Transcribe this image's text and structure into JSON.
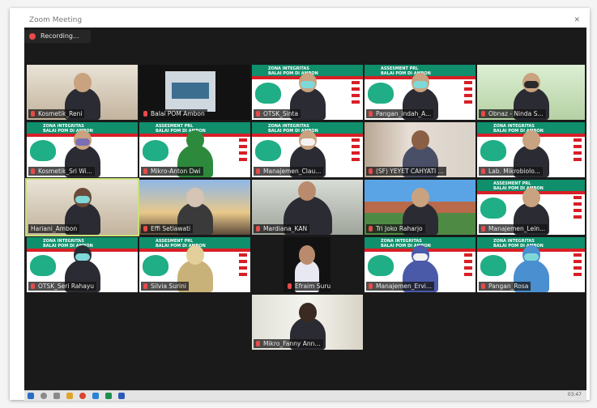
{
  "window": {
    "title": "Zoom Meeting",
    "close_glyph": "✕"
  },
  "recording": {
    "label": "Recording..."
  },
  "banner": {
    "line1": "ZONA INTEGRITAS",
    "line2": "BALAI POM DI AMBON",
    "line3": "ASSESMENT PRL"
  },
  "participants": [
    {
      "name": "Kosmetik_Reni"
    },
    {
      "name": "Balai POM Ambon"
    },
    {
      "name": "OTSK_Sinta"
    },
    {
      "name": "Pangan_indah_A..."
    },
    {
      "name": "Obnaz - Ninda S..."
    },
    {
      "name": "Kosmetik_Sri Wi..."
    },
    {
      "name": "Mikro-Anton Dwi"
    },
    {
      "name": "Manajemen_Clau..."
    },
    {
      "name": "(SF) YEYET CAHYATI ..."
    },
    {
      "name": "Lab. Mikrobiolo..."
    },
    {
      "name": "Hariani_Ambon"
    },
    {
      "name": "Effi Setiawati"
    },
    {
      "name": "Mardiana_KAN"
    },
    {
      "name": "Tri Joko Raharjo"
    },
    {
      "name": "Manajemen_Lein..."
    },
    {
      "name": "OTSK_Seri Rahayu"
    },
    {
      "name": "Silvia Surini"
    },
    {
      "name": "Efraim Suru"
    },
    {
      "name": "Manajemen_Ervi..."
    },
    {
      "name": "Pangan_Rosa"
    },
    {
      "name": "Mikro_Fanny Ann..."
    }
  ],
  "taskbar": {
    "time": "03:47"
  },
  "colors": {
    "banner_green": "#0f8f6c",
    "flag_red": "#d81f26",
    "active_speaker": "#c9e27b",
    "recording_dot": "#e64a4a"
  }
}
